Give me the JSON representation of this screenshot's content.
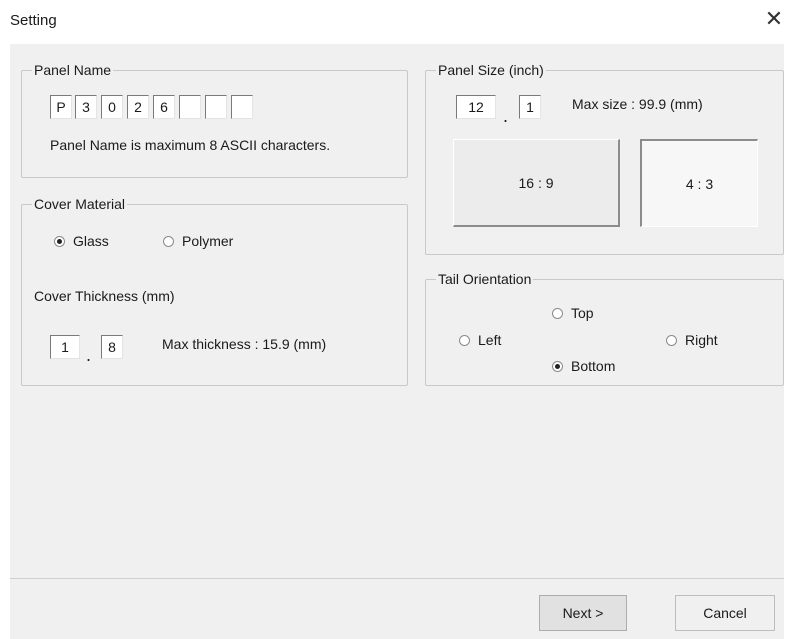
{
  "window": {
    "title": "Setting",
    "close_glyph": "✕"
  },
  "panel_name": {
    "legend": "Panel Name",
    "chars": [
      "P",
      "3",
      "0",
      "2",
      "6",
      "",
      "",
      ""
    ],
    "hint": "Panel Name is maximum 8 ASCII characters."
  },
  "cover_material": {
    "legend": "Cover Material",
    "options": [
      {
        "label": "Glass",
        "selected": true
      },
      {
        "label": "Polymer",
        "selected": false
      }
    ]
  },
  "cover_thickness": {
    "legend": "Cover Thickness (mm)",
    "integer": "1",
    "decimal": "8",
    "separator": ".",
    "max_text": "Max thickness : 15.9 (mm)"
  },
  "panel_size": {
    "legend": "Panel Size (inch)",
    "integer": "12",
    "decimal": "1",
    "separator": ".",
    "max_text": "Max size : 99.9 (mm)",
    "ratio_16_9": "16 : 9",
    "ratio_4_3": "4 : 3",
    "selected_ratio": "4 : 3"
  },
  "tail_orientation": {
    "legend": "Tail Orientation",
    "top": "Top",
    "left": "Left",
    "right": "Right",
    "bottom": "Bottom",
    "selected": "Bottom"
  },
  "footer": {
    "next_label": "Next >",
    "cancel_label": "Cancel"
  }
}
